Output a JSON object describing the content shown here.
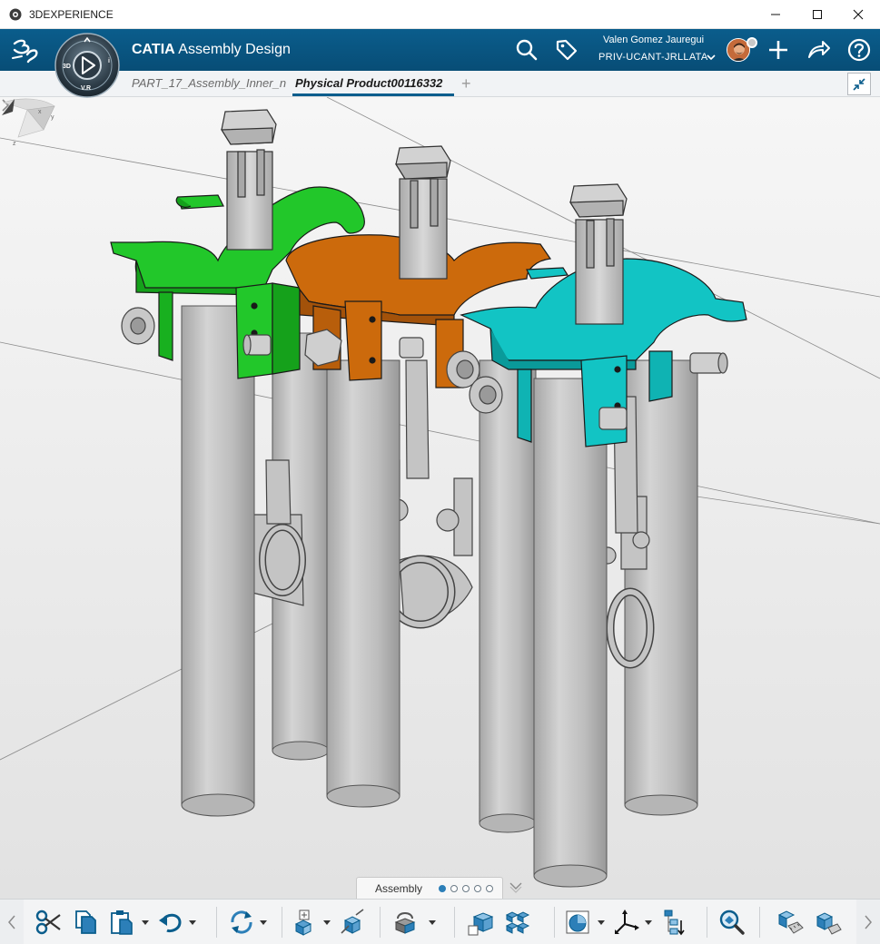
{
  "window": {
    "title": "3DEXPERIENCE"
  },
  "header": {
    "brand": "CATIA",
    "app": "Assembly Design",
    "compass_label": "V.R",
    "compass_3d": "3D",
    "compass_i": "i",
    "user": {
      "name": "Valen Gomez Jauregui",
      "org": "PRIV-UCANT-JRLLATA"
    }
  },
  "tabs": [
    {
      "label": "PART_17_Assembly_Inner_n",
      "active": false
    },
    {
      "label": "Physical Product00116332",
      "active": true
    }
  ],
  "tab_add": "+",
  "viewport": {
    "axis_labels": {
      "x": "x",
      "y": "y",
      "z": "z"
    },
    "part_colors": {
      "left_plate": "#1ec81e",
      "middle_plate": "#c8650c",
      "right_plate": "#0fbfbf",
      "steel": "#c2c2c2"
    }
  },
  "section_bar": {
    "label": "Assembly",
    "pages": 5,
    "active_page": 1
  },
  "toolbar": {
    "buttons": [
      "cut",
      "copy",
      "paste",
      "undo",
      "update",
      "insert-component",
      "exploded-view",
      "create-constraint",
      "fix-component",
      "assembly-structure",
      "clash-analysis",
      "view-mode",
      "compass-axis",
      "tree-reorder",
      "magnify",
      "measure-item",
      "measure-between"
    ]
  }
}
